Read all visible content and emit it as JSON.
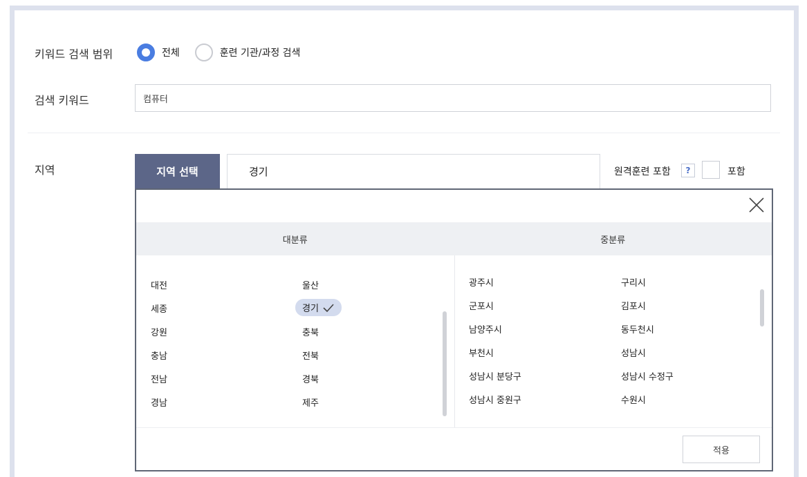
{
  "search_scope": {
    "label": "키워드 검색 범위",
    "options": [
      {
        "label": "전체",
        "checked": true
      },
      {
        "label": "훈련 기관/과정 검색",
        "checked": false
      }
    ]
  },
  "keyword": {
    "label": "검색 키워드",
    "value": "컴퓨터"
  },
  "region": {
    "label": "지역",
    "tab_label": "지역 선택",
    "selected_value": "경기",
    "remote_label": "원격훈련 포함",
    "help_label": "?",
    "include_label": "포함",
    "include_checked": false
  },
  "panel": {
    "major_header": "대분류",
    "minor_header": "중분류",
    "major_items": [
      "대전",
      "울산",
      "세종",
      "경기",
      "강원",
      "충북",
      "충남",
      "전북",
      "전남",
      "경북",
      "경남",
      "제주"
    ],
    "selected_major": "경기",
    "minor_items": [
      "광주시",
      "구리시",
      "군포시",
      "김포시",
      "남양주시",
      "동두천시",
      "부천시",
      "성남시",
      "성남시 분당구",
      "성남시 수정구",
      "성남시 중원구",
      "수원시"
    ],
    "apply_label": "적용"
  },
  "colors": {
    "accent": "#4a7de1",
    "tab_bg": "#5c6688",
    "selected_chip": "#d3dbee",
    "frame": "#dde1ed"
  }
}
